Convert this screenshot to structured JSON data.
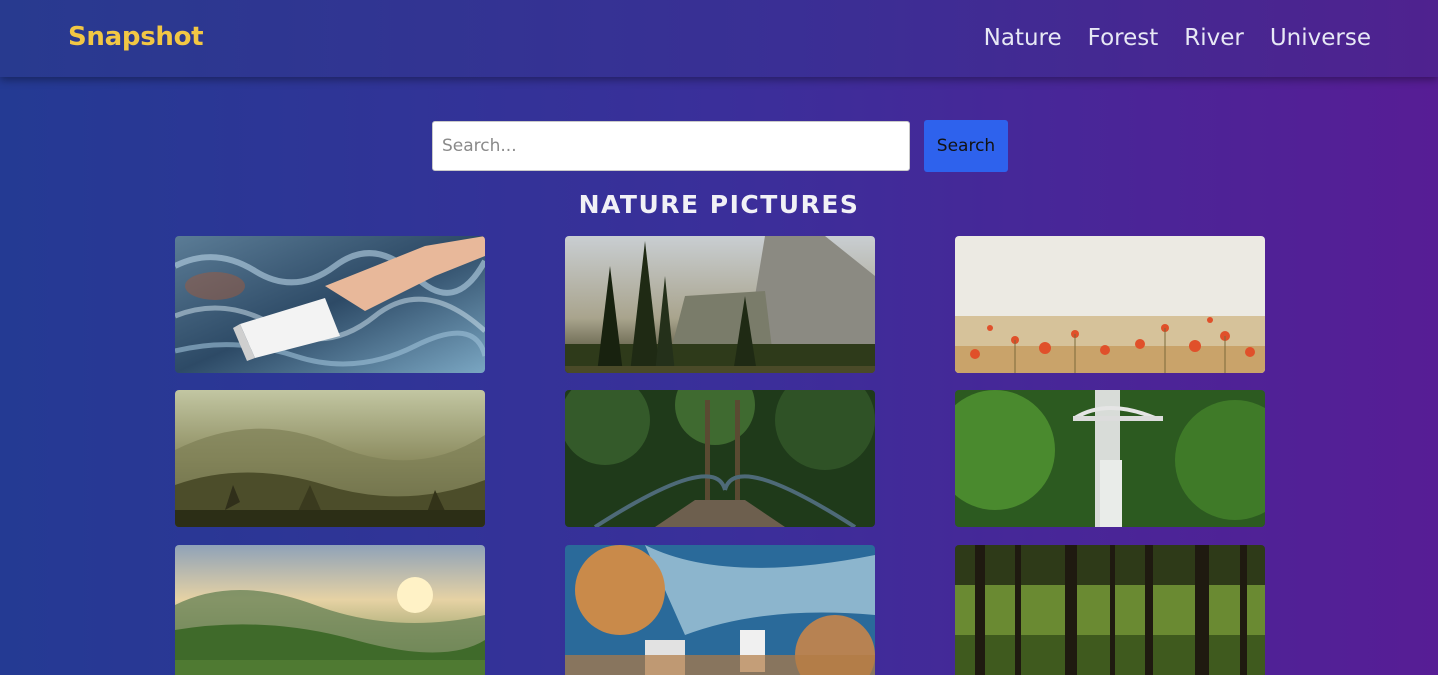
{
  "header": {
    "logo": "Snapshot",
    "nav": [
      "Nature",
      "Forest",
      "River",
      "Universe"
    ]
  },
  "search": {
    "placeholder": "Search...",
    "button_label": "Search"
  },
  "gallery": {
    "title": "NATURE PICTURES",
    "images": [
      "hand-with-water-carton-image",
      "yosemite-cliff-pines-image",
      "poppy-field-image",
      "misty-mountains-image",
      "forest-bridge-image",
      "waterfall-bridge-image",
      "green-cliffs-sunset-image",
      "people-on-coast-image",
      "forest-trees-image"
    ]
  },
  "colors": {
    "logo": "#f2c744",
    "search_button": "#2e62ed",
    "background_left": "#243a93",
    "background_right": "#571d95"
  }
}
